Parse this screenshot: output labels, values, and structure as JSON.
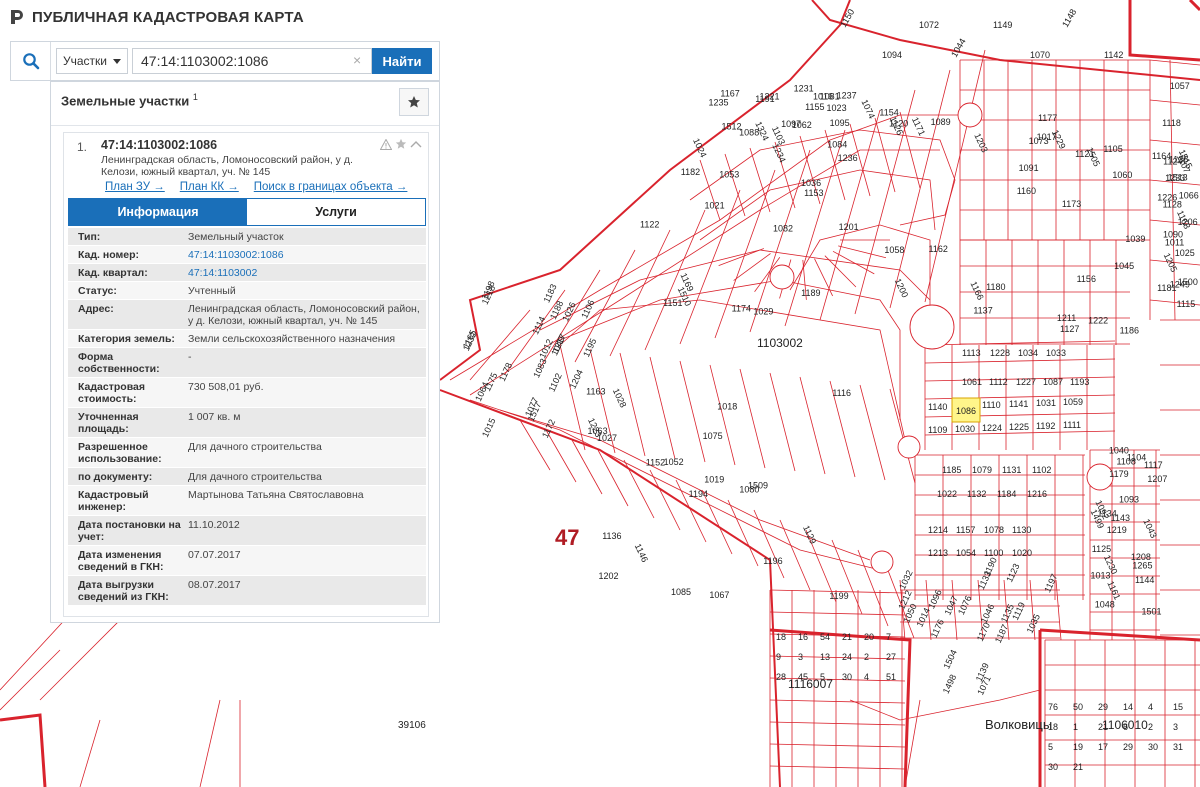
{
  "app": {
    "title": "ПУБЛИЧНАЯ КАДАСТРОВАЯ КАРТА"
  },
  "search": {
    "type_label": "Участки",
    "query": "47:14:1103002:1086",
    "button_label": "Найти",
    "clear_glyph": "×"
  },
  "panel": {
    "title": "Земельные участки",
    "count": "1",
    "result": {
      "number": "1.",
      "id": "47:14:1103002:1086",
      "address": "Ленинградская область, Ломоносовский район, у д. Келози, южный квартал, уч. № 145",
      "links": [
        "План ЗУ →",
        "План КК →",
        "Поиск в границах объекта →"
      ]
    },
    "tabs": {
      "info": "Информация",
      "services": "Услуги"
    },
    "rows": [
      {
        "label": "Тип:",
        "value": "Земельный участок"
      },
      {
        "label": "Кад. номер:",
        "value": "47:14:1103002:1086"
      },
      {
        "label": "Кад. квартал:",
        "value": "47:14:1103002"
      },
      {
        "label": "Статус:",
        "value": "Учтенный"
      },
      {
        "label": "Адрес:",
        "value": "Ленинградская область, Ломоносовский район, у д. Келози, южный квартал, уч. № 145"
      },
      {
        "label": "Категория земель:",
        "value": "Земли сельскохозяйственного назначения"
      },
      {
        "label": "Форма собственности:",
        "value": "-"
      },
      {
        "label": "Кадастровая стоимость:",
        "value": "730 508,01 руб."
      },
      {
        "label": "Уточненная площадь:",
        "value": "1 007 кв. м"
      },
      {
        "label": "Разрешенное использование:",
        "value": "Для дачного строительства"
      },
      {
        "label": "по документу:",
        "value": "Для дачного строительства"
      },
      {
        "label": "Кадастровый инженер:",
        "value": "Мартынова Татьяна Святославовна"
      },
      {
        "label": "Дата постановки на учет:",
        "value": "11.10.2012"
      },
      {
        "label": "Дата изменения сведений в ГКН:",
        "value": "07.07.2017"
      },
      {
        "label": "Дата выгрузки сведений из ГКН:",
        "value": "08.07.2017"
      }
    ]
  },
  "map": {
    "quarter_label": "1103002",
    "district_label": "47",
    "village_label": "Волковицы",
    "block_labels": [
      "1116007",
      "1106010",
      "39106"
    ],
    "selected_parcel": "1086",
    "parcels_row1": [
      "1140",
      "1086",
      "1110",
      "1141",
      "1031",
      "1059"
    ],
    "parcels_row2": [
      "1109",
      "1030",
      "1224",
      "1225",
      "1192",
      "1111"
    ],
    "parcels_row3": [
      "1113",
      "1228",
      "1034",
      "1033"
    ],
    "parcels_row4": [
      "1061",
      "1112",
      "1227",
      "1087",
      "1193"
    ],
    "parcels_row5": [
      "1185",
      "1079",
      "1131",
      "1102"
    ],
    "parcels_row6": [
      "1022",
      "1132",
      "1184",
      "1216"
    ],
    "parcels_row7": [
      "1214",
      "1157",
      "1078",
      "1130"
    ],
    "parcels_row8": [
      "1213",
      "1054",
      "1100",
      "1020"
    ],
    "parcels_top": [
      "1150",
      "1094",
      "1072",
      "1044",
      "1149",
      "1070",
      "1148",
      "1142"
    ],
    "parcels_misc": [
      "1083",
      "1027",
      "1082",
      "1137",
      "1135",
      "1161",
      "1057",
      "1081",
      "1026",
      "1080",
      "1024",
      "1186",
      "1014",
      "1207",
      "1128",
      "1074",
      "1015",
      "1075",
      "1153",
      "1180",
      "1076",
      "1048",
      "1181",
      "1016",
      "1049",
      "1129",
      "1182",
      "1017",
      "1050",
      "1208",
      "1515",
      "1155",
      "1077",
      "1019",
      "1053",
      "1505",
      "1504",
      "1501",
      "1500",
      "1154",
      "1183",
      "1052",
      "1021",
      "1156",
      "1498",
      "1499",
      "1513",
      "1512",
      "1517",
      "1509",
      "1510",
      "1060",
      "1032",
      "1265",
      "1249",
      "1324",
      "1218",
      "1163",
      "1189",
      "1105",
      "1190",
      "1219",
      "1164",
      "1191",
      "1106",
      "1028",
      "1084",
      "1073",
      "1046",
      "1013",
      "1205",
      "1097",
      "1204",
      "1152",
      "1151",
      "1203",
      "1096",
      "1125",
      "1124",
      "1095",
      "1012",
      "1202",
      "1201",
      "1045",
      "1071",
      "1043",
      "1011",
      "1120",
      "1172",
      "1196",
      "1234",
      "1039",
      "1119",
      "1144",
      "1233",
      "1171",
      "1232",
      "1067",
      "1236",
      "1121",
      "1176",
      "1040",
      "1066",
      "1235",
      "1175",
      "1146",
      "1174",
      "1173",
      "1197",
      "1143",
      "1168",
      "1167",
      "1114",
      "1194",
      "1088",
      "1166",
      "1170",
      "1117",
      "1118",
      "1231",
      "1064",
      "1116",
      "1036",
      "1091",
      "1035",
      "1230",
      "1115",
      "1062",
      "1195",
      "1063",
      "1169",
      "1127",
      "1047",
      "1179",
      "1206",
      "1126",
      "1178",
      "1136",
      "1162",
      "1160",
      "1187",
      "1134",
      "1025",
      "1023",
      "1217",
      "1223",
      "1029",
      "1222",
      "1139",
      "1108",
      "1107",
      "1221",
      "1165",
      "1085",
      "1058",
      "1229",
      "1133",
      "1093",
      "1226",
      "1237",
      "1102",
      "1018",
      "1122",
      "1177",
      "1123",
      "1092",
      "1090",
      "1089",
      "1198",
      "1199",
      "1200",
      "1211",
      "1212",
      "1104",
      "1138",
      "1103",
      "1188"
    ],
    "lot_small": [
      "18",
      "16",
      "54",
      "21",
      "20",
      "7",
      "9",
      "3",
      "13",
      "24",
      "2",
      "27",
      "28",
      "45",
      "5",
      "30",
      "4",
      "51",
      "76",
      "50",
      "29",
      "14",
      "4",
      "15",
      "18",
      "1",
      "21",
      "6",
      "2",
      "3",
      "5",
      "19",
      "17",
      "29",
      "30",
      "31",
      "30",
      "21"
    ]
  }
}
